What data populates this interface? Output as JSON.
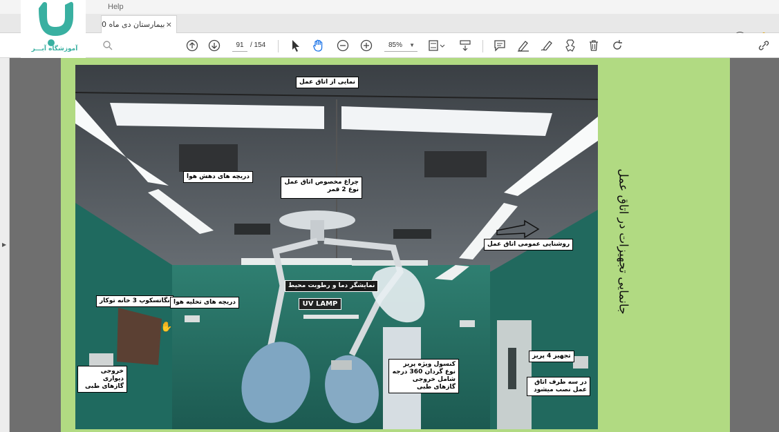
{
  "menu": {
    "help": "Help"
  },
  "tab": {
    "title": "بیمارستان دی ماه 0",
    "close": "×"
  },
  "logo": {
    "text": "آموزشگاه آبـــر"
  },
  "toolbar": {
    "page_current": "91",
    "page_total": "/ 154",
    "zoom": "85%",
    "icons": [
      "search-icon",
      "page-up-icon",
      "page-down-icon",
      "select-cursor-icon",
      "hand-tool-icon",
      "zoom-out-icon",
      "zoom-in-icon",
      "fit-page-icon",
      "scroll-mode-icon",
      "comment-icon",
      "highlight-icon",
      "sign-icon",
      "stamp-icon",
      "delete-icon",
      "rotate-icon",
      "link-icon"
    ]
  },
  "slide": {
    "side_title": "جانمایی تجهیزات در اتاق عمل",
    "labels": {
      "overview": "نمایی از اتاق عمل",
      "air_inlet": "دریچه های دهش هوا",
      "or_light": "چراغ مخصوص اتاق عمل نوع 2 قمر",
      "general_light": "روشنایی عمومی اتاق عمل",
      "env_monitor": "نمایشگر دما و رطوبت محیط",
      "uv": "UV LAMP",
      "negatoscope": "نگاتسکوپ 3 خانه توکار",
      "air_outlet": "دریچه های تخلیه هوا",
      "wall_gas": "خروجی دیواری گازهای طبی",
      "console": "کنسول ویژه پریز نوع گردان 360 درجه شامل خروجی گازهای طبی",
      "equipment4": "تجهیز 4 پریز",
      "three_sides": "در سه طرف اتاق عمل نصب میشود"
    }
  }
}
